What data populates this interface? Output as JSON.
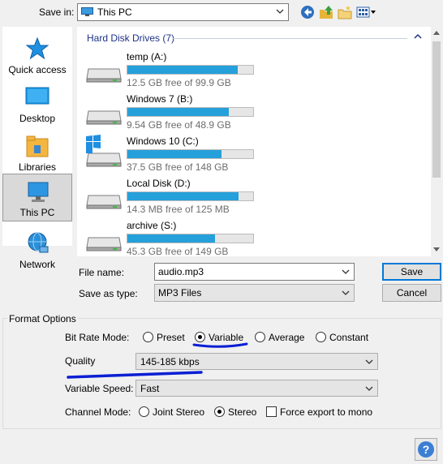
{
  "save_in": {
    "label": "Save in:",
    "value": "This PC"
  },
  "toolbar": {
    "icons": [
      "back-icon",
      "up-folder-icon",
      "new-folder-icon",
      "view-menu-icon"
    ]
  },
  "places": [
    {
      "label": "Quick access",
      "icon": "star-icon"
    },
    {
      "label": "Desktop",
      "icon": "desktop-icon"
    },
    {
      "label": "Libraries",
      "icon": "libraries-icon"
    },
    {
      "label": "This PC",
      "icon": "this-pc-icon",
      "selected": true
    },
    {
      "label": "Network",
      "icon": "network-icon"
    }
  ],
  "file_list": {
    "group_title": "Hard Disk Drives (7)",
    "drives": [
      {
        "name": "temp (A:)",
        "free_text": "12.5 GB free of 99.9 GB",
        "used_fraction": 0.875
      },
      {
        "name": "Windows 7 (B:)",
        "free_text": "9.54 GB free of 48.9 GB",
        "used_fraction": 0.805
      },
      {
        "name": "Windows 10 (C:)",
        "free_text": "37.5 GB free of 148 GB",
        "used_fraction": 0.747
      },
      {
        "name": "Local Disk (D:)",
        "free_text": "14.3 MB free of 125 MB",
        "used_fraction": 0.886
      },
      {
        "name": "archive (S:)",
        "free_text": "45.3 GB free of 149 GB",
        "used_fraction": 0.696
      }
    ]
  },
  "file_name": {
    "label": "File name:",
    "value": "audio.mp3"
  },
  "save_as_type": {
    "label": "Save as type:",
    "value": "MP3 Files"
  },
  "buttons": {
    "save": "Save",
    "cancel": "Cancel"
  },
  "format_options": {
    "title": "Format Options",
    "bit_rate_mode": {
      "label": "Bit Rate Mode:",
      "options": [
        "Preset",
        "Variable",
        "Average",
        "Constant"
      ],
      "selected": "Variable"
    },
    "quality": {
      "label": "Quality",
      "value": "145-185 kbps"
    },
    "variable_speed": {
      "label": "Variable Speed:",
      "value": "Fast"
    },
    "channel_mode": {
      "label": "Channel Mode:",
      "options": [
        "Joint Stereo",
        "Stereo"
      ],
      "selected": "Stereo",
      "force_mono_label": "Force export to mono",
      "force_mono_checked": false
    }
  },
  "annotation_color": "#0b1fd4",
  "accent_color": "#26a0da"
}
